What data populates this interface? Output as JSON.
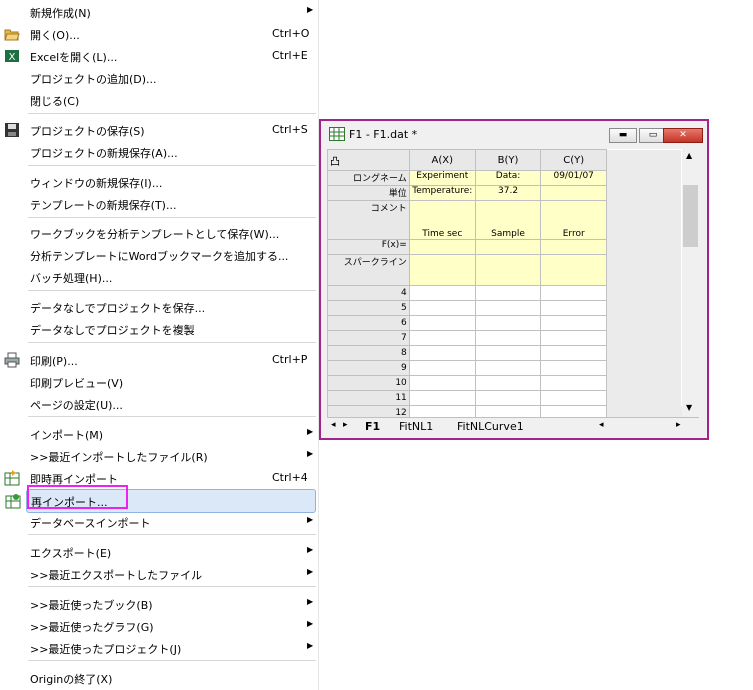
{
  "menu": {
    "items": [
      {
        "label": "新規作成(N)",
        "has_submenu": true
      },
      {
        "label": "開く(O)...",
        "shortcut": "Ctrl+O",
        "icon": "folder-open-icon"
      },
      {
        "label": "Excelを開く(L)...",
        "shortcut": "Ctrl+E",
        "icon": "excel-icon"
      },
      {
        "label": "プロジェクトの追加(D)..."
      },
      {
        "label": "閉じる(C)"
      },
      {
        "label": "プロジェクトの保存(S)",
        "shortcut": "Ctrl+S",
        "icon": "save-disk-icon"
      },
      {
        "label": "プロジェクトの新規保存(A)..."
      },
      {
        "label": "ウィンドウの新規保存(I)..."
      },
      {
        "label": "テンプレートの新規保存(T)..."
      },
      {
        "label": "ワークブックを分析テンプレートとして保存(W)..."
      },
      {
        "label": "分析テンプレートにWordブックマークを追加する..."
      },
      {
        "label": "バッチ処理(H)..."
      },
      {
        "label": "データなしでプロジェクトを保存..."
      },
      {
        "label": "データなしでプロジェクトを複製"
      },
      {
        "label": "印刷(P)...",
        "shortcut": "Ctrl+P",
        "icon": "printer-icon"
      },
      {
        "label": "印刷プレビュー(V)"
      },
      {
        "label": "ページの設定(U)..."
      },
      {
        "label": "インポート(M)",
        "has_submenu": true
      },
      {
        "label": ">>最近インポートしたファイル(R)",
        "has_submenu": true
      },
      {
        "label": "即時再インポート",
        "shortcut": "Ctrl+4",
        "icon": "reimport-directly-icon"
      },
      {
        "label": "再インポート...",
        "icon": "reimport-icon",
        "highlighted": true
      },
      {
        "label": "データベースインポート",
        "has_submenu": true
      },
      {
        "label": "エクスポート(E)",
        "has_submenu": true
      },
      {
        "label": ">>最近エクスポートしたファイル",
        "has_submenu": true
      },
      {
        "label": ">>最近使ったブック(B)",
        "has_submenu": true
      },
      {
        "label": ">>最近使ったグラフ(G)",
        "has_submenu": true
      },
      {
        "label": ">>最近使ったプロジェクト(J)",
        "has_submenu": true
      },
      {
        "label": "Originの終了(X)"
      }
    ]
  },
  "window": {
    "title": "F1 - F1.dat *",
    "corner_label": "凸",
    "columns": [
      "A(X)",
      "B(Y)",
      "C(Y)"
    ],
    "meta_rows": [
      {
        "label": "ロングネーム",
        "values": [
          "Experiment",
          "Data:",
          "09/01/07"
        ]
      },
      {
        "label": "単位",
        "values": [
          "Temperature:",
          "37.2",
          ""
        ]
      },
      {
        "label": "コメント",
        "values": [
          "Time sec",
          "Sample",
          "Error"
        ]
      },
      {
        "label": "F(x)=",
        "values": [
          "",
          "",
          ""
        ]
      },
      {
        "label": "スパークライン",
        "values": [
          "",
          "",
          ""
        ]
      }
    ],
    "row_numbers": [
      "4",
      "5",
      "6",
      "7",
      "8",
      "9",
      "10",
      "11",
      "12"
    ],
    "tabs": [
      "F1",
      "FitNL1",
      "FitNLCurve1"
    ]
  },
  "colors": {
    "highlight_box": "#ee22ee",
    "window_border": "#a0238e",
    "metadata_bg": "#ffffc8"
  }
}
